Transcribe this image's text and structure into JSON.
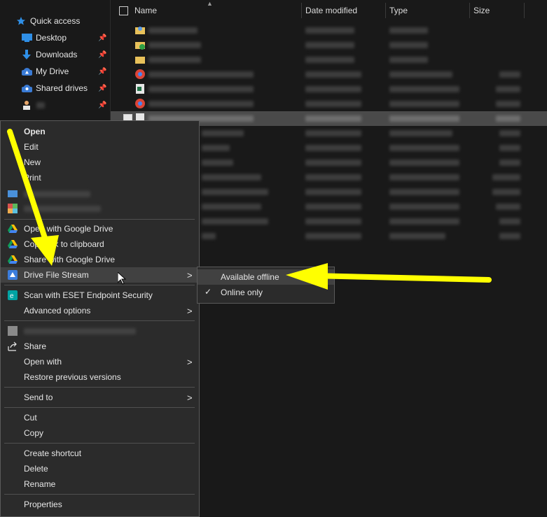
{
  "nav": {
    "items": [
      {
        "label": "Quick access",
        "icon": "star-icon"
      },
      {
        "label": "Desktop",
        "icon": "desktop-icon"
      },
      {
        "label": "Downloads",
        "icon": "download-icon"
      },
      {
        "label": "My Drive",
        "icon": "drive-icon"
      },
      {
        "label": "Shared drives",
        "icon": "shared-drives-icon"
      }
    ]
  },
  "files": {
    "columns": {
      "name": "Name",
      "date": "Date modified",
      "type": "Type",
      "size": "Size"
    }
  },
  "context_menu": {
    "open": "Open",
    "edit": "Edit",
    "new": "New",
    "print": "Print",
    "open_with_google_drive": "Open with Google Drive",
    "copy_link": "Copy link to clipboard",
    "share_google_drive": "Share with Google Drive",
    "drive_file_stream": "Drive File Stream",
    "scan_eset": "Scan with ESET Endpoint Security",
    "advanced_options": "Advanced options",
    "share": "Share",
    "open_with": "Open with",
    "restore_previous": "Restore previous versions",
    "send_to": "Send to",
    "cut": "Cut",
    "copy": "Copy",
    "create_shortcut": "Create shortcut",
    "delete": "Delete",
    "rename": "Rename",
    "properties": "Properties"
  },
  "submenu": {
    "available_offline": "Available offline",
    "online_only": "Online only"
  },
  "colors": {
    "annotation_arrow": "#ffff00",
    "menu_bg": "#2b2b2b",
    "highlight": "#414141"
  }
}
